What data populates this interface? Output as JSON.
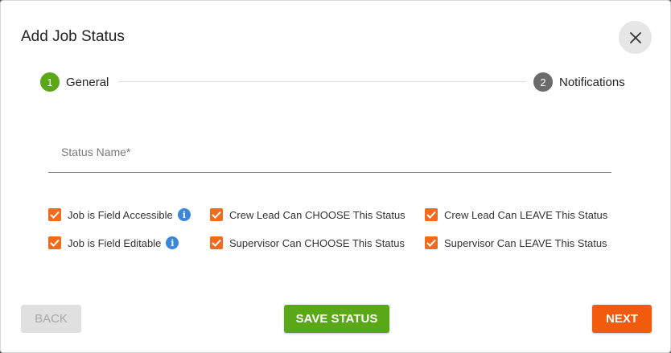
{
  "dialog": {
    "title": "Add Job Status",
    "close_icon": "close-icon"
  },
  "stepper": {
    "steps": [
      {
        "number": "1",
        "label": "General",
        "active": true,
        "color": "#5aa817"
      },
      {
        "number": "2",
        "label": "Notifications",
        "active": false,
        "color": "#6b6b6b"
      }
    ]
  },
  "form": {
    "status_name": {
      "placeholder": "Status Name*",
      "value": ""
    },
    "checkboxes": [
      {
        "label": "Job is Field Accessible",
        "checked": true,
        "info": true
      },
      {
        "label": "Crew Lead Can CHOOSE This Status",
        "checked": true,
        "info": false
      },
      {
        "label": "Crew Lead Can LEAVE This Status",
        "checked": true,
        "info": false
      },
      {
        "label": "Job is Field Editable",
        "checked": true,
        "info": true
      },
      {
        "label": "Supervisor Can CHOOSE This Status",
        "checked": true,
        "info": false
      },
      {
        "label": "Supervisor Can LEAVE This Status",
        "checked": true,
        "info": false
      }
    ],
    "info_glyph": "i"
  },
  "actions": {
    "back_label": "BACK",
    "save_label": "SAVE STATUS",
    "next_label": "NEXT"
  },
  "colors": {
    "checkbox": "#f26b1d",
    "save": "#5aa817",
    "next": "#f25a0c",
    "info": "#3a86d8"
  }
}
